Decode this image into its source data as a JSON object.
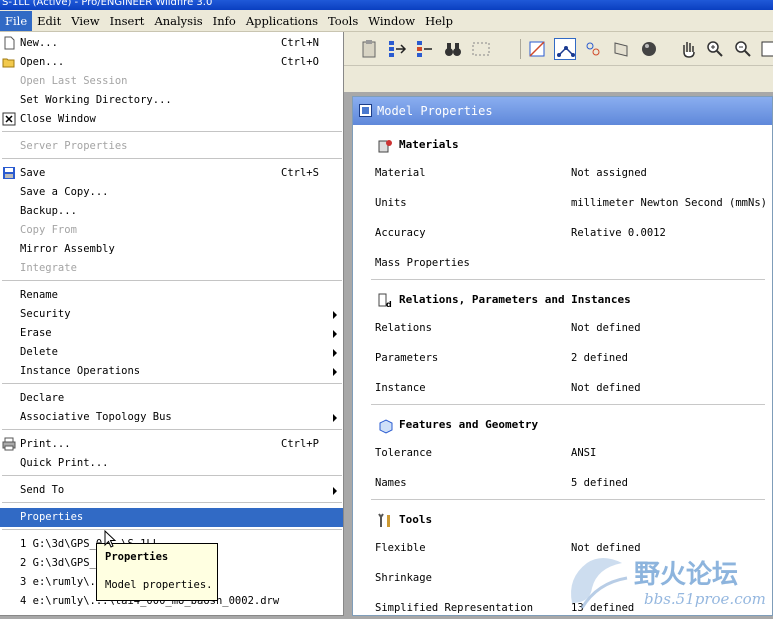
{
  "window": {
    "title": "S-1LL (Active) - Pro/ENGINEER Wildfire 3.0"
  },
  "menubar": [
    {
      "label": "File",
      "active": true
    },
    {
      "label": "Edit"
    },
    {
      "label": "View"
    },
    {
      "label": "Insert"
    },
    {
      "label": "Analysis"
    },
    {
      "label": "Info"
    },
    {
      "label": "Applications"
    },
    {
      "label": "Tools"
    },
    {
      "label": "Window"
    },
    {
      "label": "Help"
    }
  ],
  "file_menu": {
    "new": {
      "label": "New...",
      "accel": "Ctrl+N",
      "icon": "new-file-icon"
    },
    "open": {
      "label": "Open...",
      "accel": "Ctrl+O",
      "icon": "open-folder-icon"
    },
    "open_last": {
      "label": "Open Last Session"
    },
    "set_wd": {
      "label": "Set Working Directory..."
    },
    "close_window": {
      "label": "Close Window",
      "icon": "close-window-icon"
    },
    "server_props": {
      "label": "Server Properties"
    },
    "save": {
      "label": "Save",
      "accel": "Ctrl+S",
      "icon": "save-icon"
    },
    "save_copy": {
      "label": "Save a Copy..."
    },
    "backup": {
      "label": "Backup..."
    },
    "copy_from": {
      "label": "Copy From"
    },
    "mirror_assembly": {
      "label": "Mirror Assembly"
    },
    "integrate": {
      "label": "Integrate"
    },
    "rename": {
      "label": "Rename"
    },
    "security": {
      "label": "Security"
    },
    "erase": {
      "label": "Erase"
    },
    "delete": {
      "label": "Delete"
    },
    "instance_ops": {
      "label": "Instance Operations"
    },
    "declare": {
      "label": "Declare"
    },
    "assoc_topology": {
      "label": "Associative Topology Bus"
    },
    "print": {
      "label": "Print...",
      "accel": "Ctrl+P",
      "icon": "printer-icon"
    },
    "quick_print": {
      "label": "Quick Print..."
    },
    "send_to": {
      "label": "Send To"
    },
    "properties": {
      "label": "Properties"
    },
    "recent": [
      "1 G:\\3d\\GPS_0...\\S-1LL",
      "2 G:\\3d\\GPS_0...",
      "3 e:\\rumly\\...\\..._0002.drw",
      "4 e:\\rumly\\...\\tai4_000_mo_baosh_0002.drw"
    ]
  },
  "tooltip": {
    "title": "Properties",
    "desc": "Model properties."
  },
  "panel": {
    "title": "Model Properties",
    "sections": {
      "materials": {
        "title": "Materials",
        "rows": [
          {
            "k": "Material",
            "v": "Not assigned"
          },
          {
            "k": "Units",
            "v": "millimeter Newton Second (mmNs)"
          },
          {
            "k": "Accuracy",
            "v": "Relative 0.0012"
          },
          {
            "k": "Mass Properties",
            "v": ""
          }
        ]
      },
      "relations": {
        "title": "Relations, Parameters and Instances",
        "rows": [
          {
            "k": "Relations",
            "v": "Not defined"
          },
          {
            "k": "Parameters",
            "v": "2 defined"
          },
          {
            "k": "Instance",
            "v": "Not defined"
          }
        ]
      },
      "features": {
        "title": "Features and Geometry",
        "rows": [
          {
            "k": "Tolerance",
            "v": "ANSI"
          },
          {
            "k": "Names",
            "v": "5 defined"
          }
        ]
      },
      "tools": {
        "title": "Tools",
        "rows": [
          {
            "k": "Flexible",
            "v": "Not defined"
          },
          {
            "k": "Shrinkage",
            "v": ""
          },
          {
            "k": "Simplified Representation",
            "v": "13 defined"
          }
        ]
      }
    }
  },
  "watermark": {
    "cn": "野火论坛",
    "url": "bbs.51proe.com"
  },
  "colors": {
    "highlight": "#316ac5",
    "panel_title": "#6f95e0",
    "tooltip_bg": "#ffffe1"
  }
}
